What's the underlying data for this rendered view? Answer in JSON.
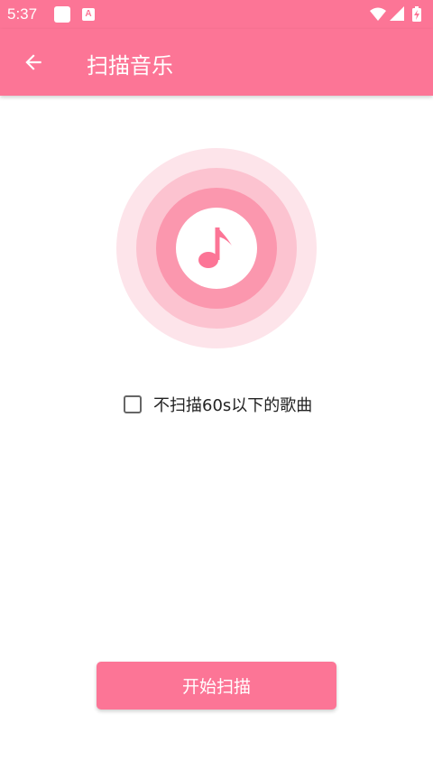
{
  "status_bar": {
    "time": "5:37",
    "icons": [
      "notification-square-icon",
      "a-badge-icon",
      "wifi-icon",
      "signal-icon",
      "battery-charging-icon"
    ]
  },
  "app_bar": {
    "back_icon": "arrow-left-icon",
    "title": "扫描音乐"
  },
  "hero": {
    "icon": "music-note-icon",
    "colors": {
      "outer": "#fde4ea",
      "middle": "#fcc3d0",
      "inner": "#fb97ae",
      "core": "#ffffff",
      "note": "#fc7596"
    }
  },
  "options": {
    "skip_short_label": "不扫描60s以下的歌曲",
    "skip_short_checked": false
  },
  "actions": {
    "start_label": "开始扫描"
  },
  "colors": {
    "accent": "#fc7596"
  }
}
